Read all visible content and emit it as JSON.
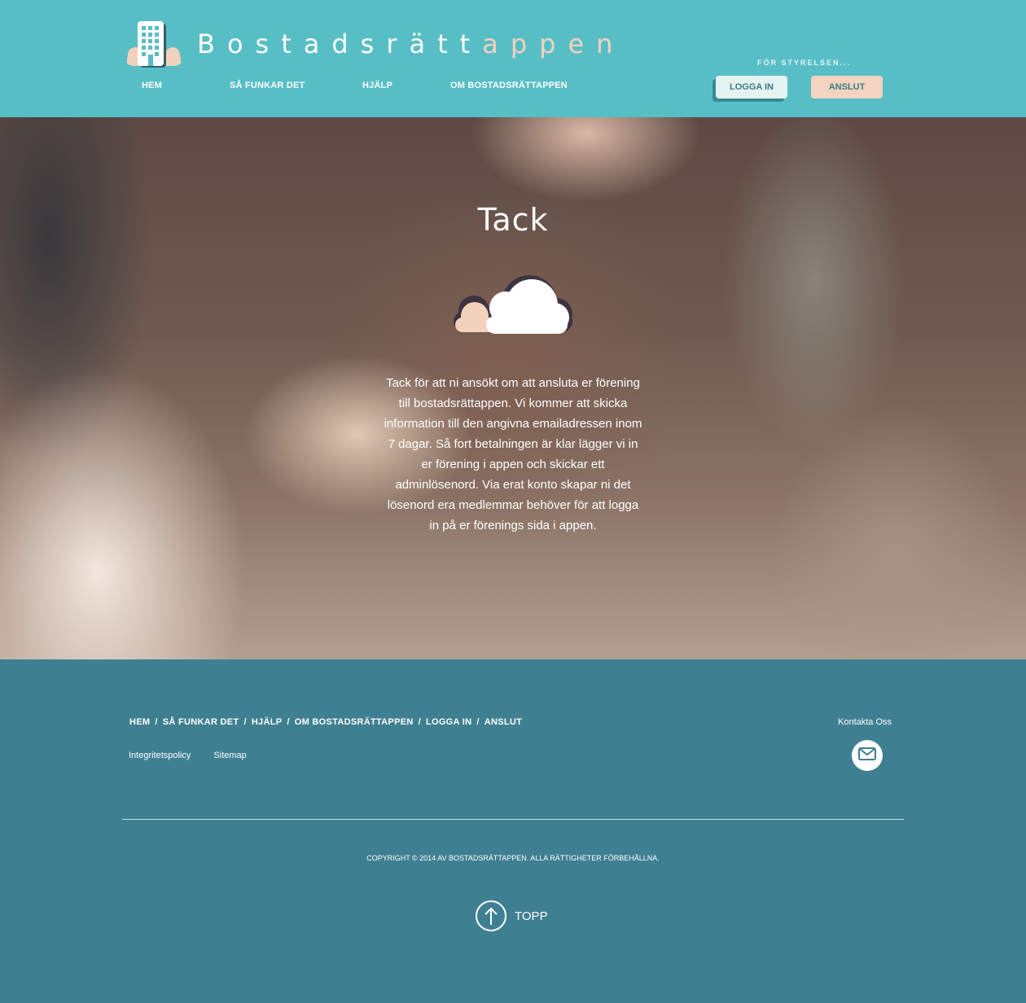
{
  "header": {
    "logo_main": "Bostadsrätt",
    "logo_accent": "appen",
    "nav": [
      "HEM",
      "SÅ FUNKAR DET",
      "HJÄLP",
      "OM BOSTADSRÄTTAPPEN"
    ],
    "board_label": "FÖR STYRELSEN...",
    "login_label": "LOGGA IN",
    "join_label": "ANSLUT"
  },
  "hero": {
    "title": "Tack",
    "message": "Tack för att ni ansökt om att ansluta er förening till bostadsrättappen. Vi kommer att skicka information till den angivna emailadressen inom 7 dagar. Så fort betalningen är klar lägger vi in er förening i appen och skickar ett adminlösenord. Via erat konto skapar ni det lösenord era medlemmar behöver för att logga in på er förenings sida i appen."
  },
  "footer": {
    "nav": [
      "HEM",
      "SÅ FUNKAR DET",
      "HJÄLP",
      "OM BOSTADSRÄTTAPPEN",
      "LOGGA IN",
      "ANSLUT"
    ],
    "separator": "/",
    "privacy": "Integritetspolicy",
    "sitemap": "Sitemap",
    "contact_label": "Kontakta Oss",
    "copyright": "COPYRIGHT © 2014 AV BOSTADSRÄTTAPPEN. ALLA RÄTTIGHETER FÖRBEHÅLLNA.",
    "top_label": "TOPP"
  },
  "colors": {
    "header_bg": "#58bec6",
    "footer_bg": "#3f7f92",
    "accent_peach": "#f2d2bd",
    "login_bg": "#e4f3ef"
  },
  "icons": [
    "building-logo-icon",
    "cloud-icon",
    "mail-icon",
    "arrow-up-icon"
  ]
}
